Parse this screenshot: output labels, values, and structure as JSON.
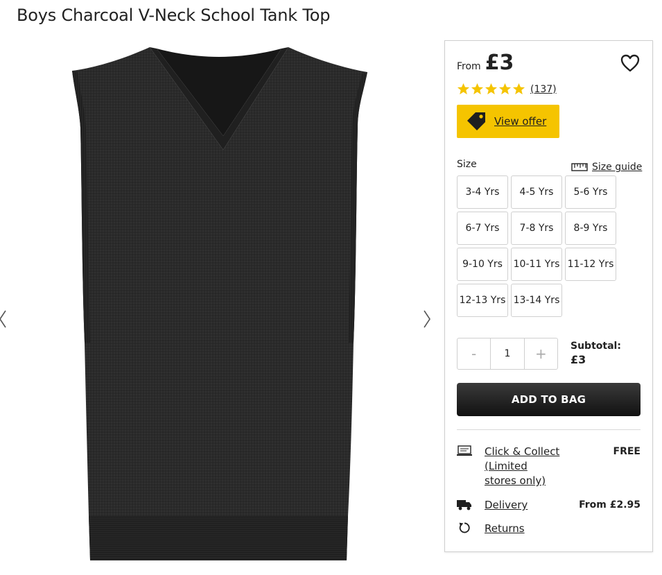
{
  "product": {
    "title": "Boys Charcoal V-Neck School Tank Top"
  },
  "price": {
    "from_label": "From",
    "value": "£3"
  },
  "rating": {
    "stars": 5,
    "count": "(137)",
    "star_color": "#f5c400"
  },
  "offer": {
    "label": "View offer",
    "color": "#f5c400"
  },
  "size": {
    "label": "Size",
    "guide_label": "Size guide",
    "options": [
      "3-4 Yrs",
      "4-5 Yrs",
      "5-6 Yrs",
      "6-7 Yrs",
      "7-8 Yrs",
      "8-9 Yrs",
      "9-10 Yrs",
      "10-11 Yrs",
      "11-12 Yrs",
      "12-13 Yrs",
      "13-14 Yrs"
    ]
  },
  "quantity": {
    "minus": "-",
    "value": "1",
    "plus": "+"
  },
  "subtotal": {
    "label": "Subtotal:",
    "value": "£3"
  },
  "add_to_bag": "ADD TO BAG",
  "delivery": {
    "click_collect_label": "Click & Collect (Limited stores only)",
    "click_collect_cost": "FREE",
    "delivery_label": "Delivery",
    "delivery_cost": "From £2.95",
    "returns_label": "Returns"
  }
}
